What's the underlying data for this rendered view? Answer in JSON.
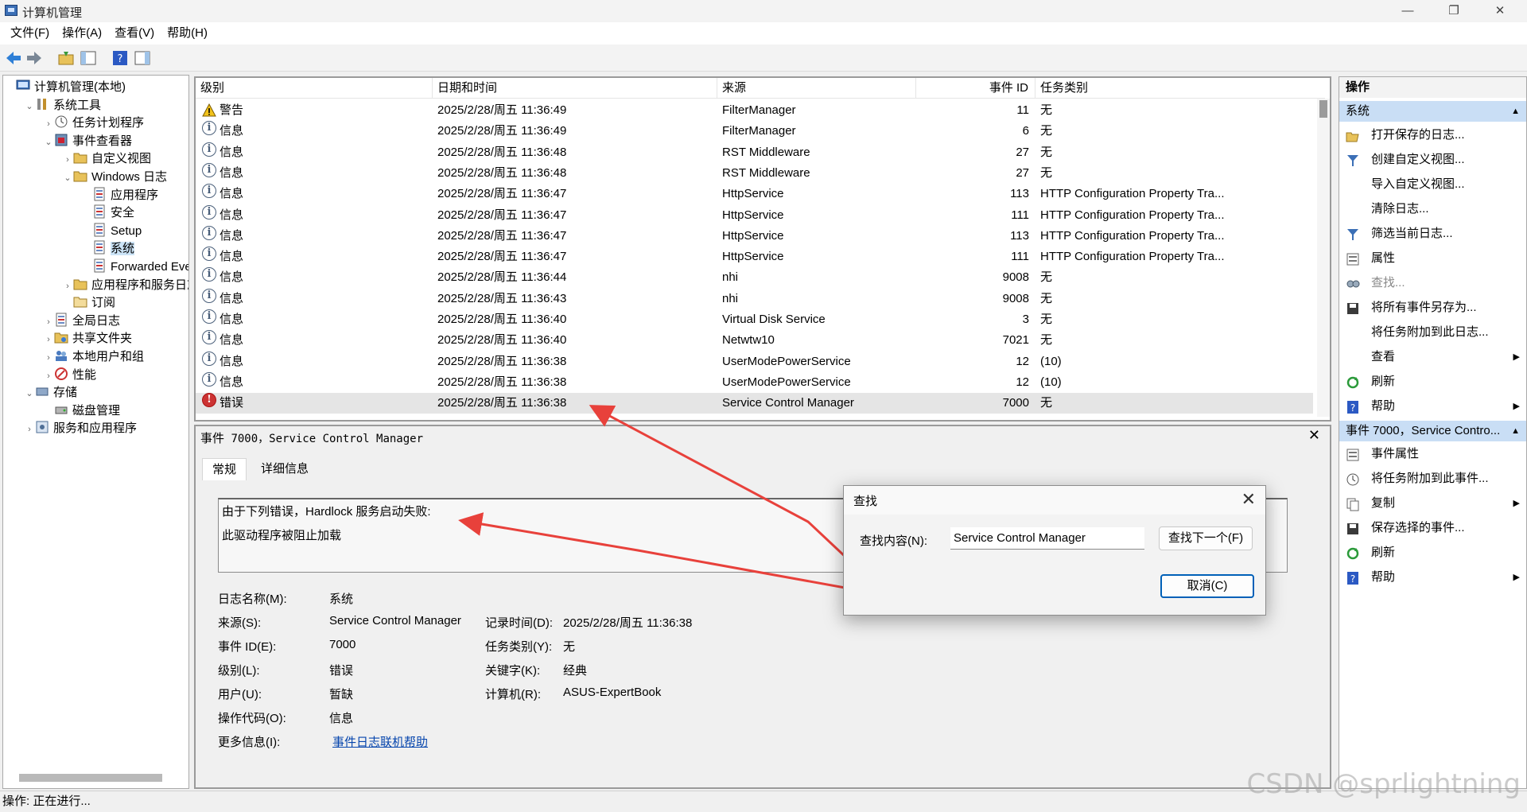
{
  "window": {
    "title": "计算机管理"
  },
  "menu": [
    "文件(F)",
    "操作(A)",
    "查看(V)",
    "帮助(H)"
  ],
  "tree": [
    {
      "label": "计算机管理(本地)",
      "indent": 0,
      "exp": "",
      "icon": "computer-management-icon"
    },
    {
      "label": "系统工具",
      "indent": 1,
      "exp": "⌄",
      "icon": "tools-icon"
    },
    {
      "label": "任务计划程序",
      "indent": 2,
      "exp": "›",
      "icon": "clock-icon"
    },
    {
      "label": "事件查看器",
      "indent": 2,
      "exp": "⌄",
      "icon": "event-viewer-icon"
    },
    {
      "label": "自定义视图",
      "indent": 3,
      "exp": "›",
      "icon": "folder-icon"
    },
    {
      "label": "Windows 日志",
      "indent": 3,
      "exp": "⌄",
      "icon": "folder-icon"
    },
    {
      "label": "应用程序",
      "indent": 4,
      "exp": "",
      "icon": "log-icon"
    },
    {
      "label": "安全",
      "indent": 4,
      "exp": "",
      "icon": "log-icon"
    },
    {
      "label": "Setup",
      "indent": 4,
      "exp": "",
      "icon": "log-icon"
    },
    {
      "label": "系统",
      "indent": 4,
      "exp": "",
      "icon": "log-icon",
      "selected": true
    },
    {
      "label": "Forwarded Even",
      "indent": 4,
      "exp": "",
      "icon": "log-icon"
    },
    {
      "label": "应用程序和服务日志",
      "indent": 3,
      "exp": "›",
      "icon": "folder-icon"
    },
    {
      "label": "订阅",
      "indent": 3,
      "exp": "",
      "icon": "subscription-icon"
    },
    {
      "label": "全局日志",
      "indent": 2,
      "exp": "›",
      "icon": "log-icon"
    },
    {
      "label": "共享文件夹",
      "indent": 2,
      "exp": "›",
      "icon": "shared-folder-icon"
    },
    {
      "label": "本地用户和组",
      "indent": 2,
      "exp": "›",
      "icon": "users-icon"
    },
    {
      "label": "性能",
      "indent": 2,
      "exp": "›",
      "icon": "performance-icon"
    },
    {
      "label": "存储",
      "indent": 1,
      "exp": "⌄",
      "icon": "storage-icon"
    },
    {
      "label": "磁盘管理",
      "indent": 2,
      "exp": "",
      "icon": "disk-icon"
    },
    {
      "label": "服务和应用程序",
      "indent": 1,
      "exp": "›",
      "icon": "services-icon"
    }
  ],
  "events": {
    "columns": [
      "级别",
      "日期和时间",
      "来源",
      "事件 ID",
      "任务类别"
    ],
    "rows": [
      {
        "level": "警告",
        "kind": "warn",
        "time": "2025/2/28/周五 11:36:49",
        "source": "FilterManager",
        "id": "11",
        "cat": "无"
      },
      {
        "level": "信息",
        "kind": "info",
        "time": "2025/2/28/周五 11:36:49",
        "source": "FilterManager",
        "id": "6",
        "cat": "无"
      },
      {
        "level": "信息",
        "kind": "info",
        "time": "2025/2/28/周五 11:36:48",
        "source": "RST Middleware",
        "id": "27",
        "cat": "无"
      },
      {
        "level": "信息",
        "kind": "info",
        "time": "2025/2/28/周五 11:36:48",
        "source": "RST Middleware",
        "id": "27",
        "cat": "无"
      },
      {
        "level": "信息",
        "kind": "info",
        "time": "2025/2/28/周五 11:36:47",
        "source": "HttpService",
        "id": "113",
        "cat": "HTTP Configuration Property Tra..."
      },
      {
        "level": "信息",
        "kind": "info",
        "time": "2025/2/28/周五 11:36:47",
        "source": "HttpService",
        "id": "111",
        "cat": "HTTP Configuration Property Tra..."
      },
      {
        "level": "信息",
        "kind": "info",
        "time": "2025/2/28/周五 11:36:47",
        "source": "HttpService",
        "id": "113",
        "cat": "HTTP Configuration Property Tra..."
      },
      {
        "level": "信息",
        "kind": "info",
        "time": "2025/2/28/周五 11:36:47",
        "source": "HttpService",
        "id": "111",
        "cat": "HTTP Configuration Property Tra..."
      },
      {
        "level": "信息",
        "kind": "info",
        "time": "2025/2/28/周五 11:36:44",
        "source": "nhi",
        "id": "9008",
        "cat": "无"
      },
      {
        "level": "信息",
        "kind": "info",
        "time": "2025/2/28/周五 11:36:43",
        "source": "nhi",
        "id": "9008",
        "cat": "无"
      },
      {
        "level": "信息",
        "kind": "info",
        "time": "2025/2/28/周五 11:36:40",
        "source": "Virtual Disk Service",
        "id": "3",
        "cat": "无"
      },
      {
        "level": "信息",
        "kind": "info",
        "time": "2025/2/28/周五 11:36:40",
        "source": "Netwtw10",
        "id": "7021",
        "cat": "无"
      },
      {
        "level": "信息",
        "kind": "info",
        "time": "2025/2/28/周五 11:36:38",
        "source": "UserModePowerService",
        "id": "12",
        "cat": "(10)"
      },
      {
        "level": "信息",
        "kind": "info",
        "time": "2025/2/28/周五 11:36:38",
        "source": "UserModePowerService",
        "id": "12",
        "cat": "(10)"
      },
      {
        "level": "错误",
        "kind": "err",
        "time": "2025/2/28/周五 11:36:38",
        "source": "Service Control Manager",
        "id": "7000",
        "cat": "无",
        "selected": true
      }
    ]
  },
  "detail": {
    "title_prefix": "事件",
    "title_rest": " 7000，Service Control Manager",
    "tabs": [
      "常规",
      "详细信息"
    ],
    "message_line1": "由于下列错误，Hardlock 服务启动失败:",
    "message_line2": "此驱动程序被阻止加载",
    "props": {
      "log_name_label": "日志名称(M):",
      "log_name": "系统",
      "source_label": "来源(S):",
      "source": "Service Control Manager",
      "recorded_label": "记录时间(D):",
      "recorded": "2025/2/28/周五 11:36:38",
      "event_id_label": "事件 ID(E):",
      "event_id": "7000",
      "task_label": "任务类别(Y):",
      "task": "无",
      "level_label": "级别(L):",
      "level": "错误",
      "keywords_label": "关键字(K):",
      "keywords": "经典",
      "user_label": "用户(U):",
      "user": "暂缺",
      "computer_label": "计算机(R):",
      "computer": "ASUS-ExpertBook",
      "opcode_label": "操作代码(O):",
      "opcode": "信息",
      "more_label": "更多信息(I):",
      "more_link": "事件日志联机帮助"
    }
  },
  "actions": {
    "header": "操作",
    "section1": "系统",
    "items1": [
      {
        "label": "打开保存的日志...",
        "icon": "open-folder-icon"
      },
      {
        "label": "创建自定义视图...",
        "icon": "filter-icon"
      },
      {
        "label": "导入自定义视图...",
        "icon": ""
      },
      {
        "label": "清除日志...",
        "icon": ""
      },
      {
        "label": "筛选当前日志...",
        "icon": "filter-icon"
      },
      {
        "label": "属性",
        "icon": "properties-icon"
      },
      {
        "label": "查找...",
        "icon": "find-icon",
        "dim": true
      },
      {
        "label": "将所有事件另存为...",
        "icon": "save-icon"
      },
      {
        "label": "将任务附加到此日志...",
        "icon": ""
      },
      {
        "label": "查看",
        "icon": "",
        "sub": true
      },
      {
        "label": "刷新",
        "icon": "refresh-icon"
      },
      {
        "label": "帮助",
        "icon": "help-icon",
        "sub": true
      }
    ],
    "section2": "事件 7000，Service Contro...",
    "items2": [
      {
        "label": "事件属性",
        "icon": "properties-icon"
      },
      {
        "label": "将任务附加到此事件...",
        "icon": "clock-icon"
      },
      {
        "label": "复制",
        "icon": "copy-icon",
        "sub": true
      },
      {
        "label": "保存选择的事件...",
        "icon": "save-icon"
      },
      {
        "label": "刷新",
        "icon": "refresh-icon"
      },
      {
        "label": "帮助",
        "icon": "help-icon",
        "sub": true
      }
    ]
  },
  "find_dialog": {
    "title": "查找",
    "label": "查找内容(N):",
    "value": "Service Control Manager",
    "next": "查找下一个(F)",
    "cancel": "取消(C)"
  },
  "status": "操作:  正在进行...",
  "watermark": "CSDN @sprlightning",
  "colors": {
    "arrow": "#e8413b",
    "selection": "#cce4f7",
    "section": "#c9def5"
  }
}
